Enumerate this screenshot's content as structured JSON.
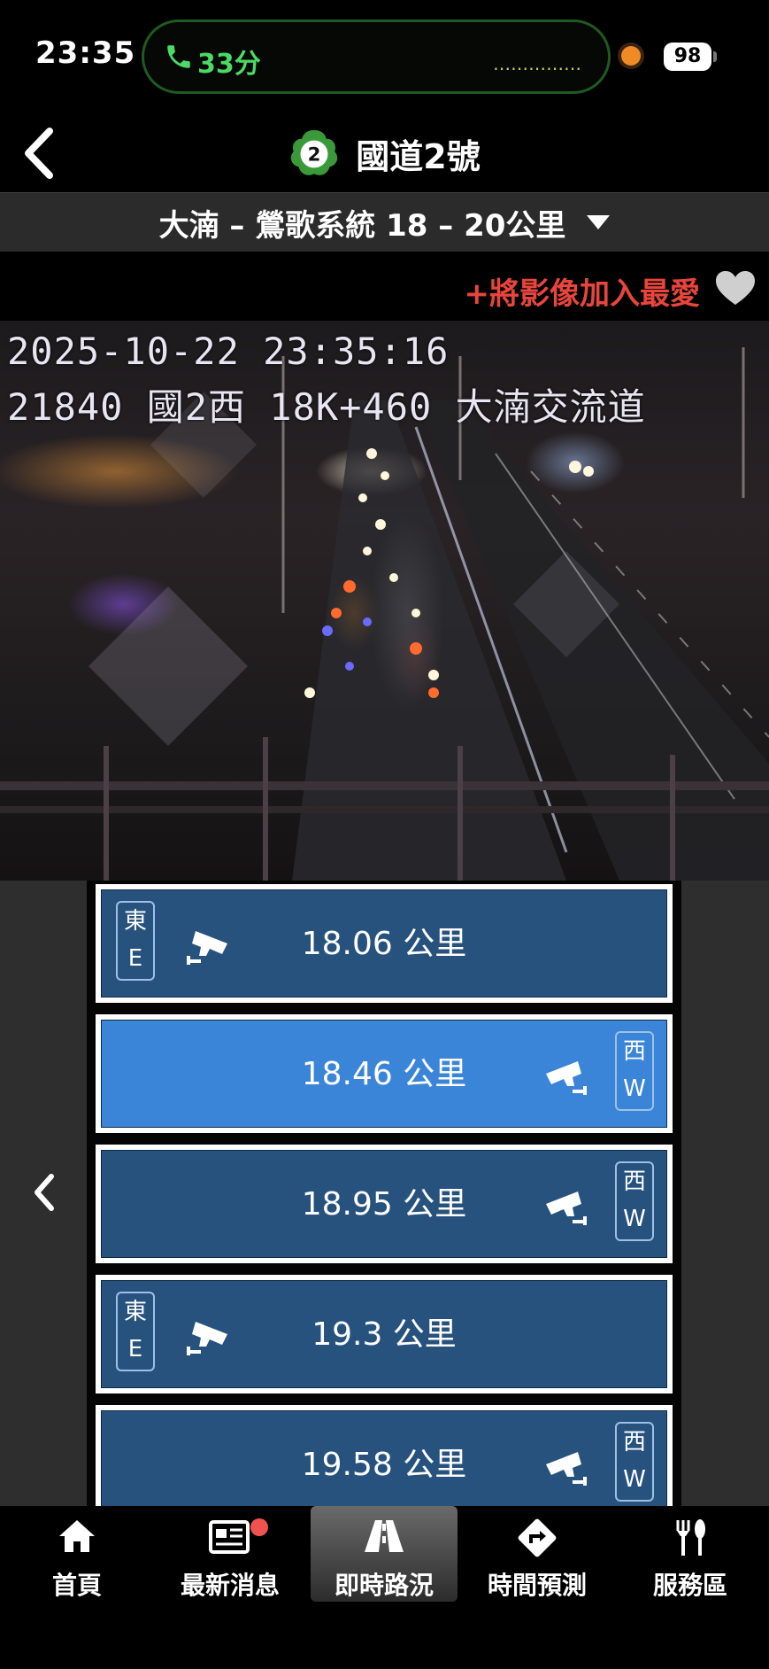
{
  "status_bar": {
    "time": "23:35",
    "call_duration": "33分",
    "battery": "98",
    "colors": {
      "call_green": "#4cd964",
      "record_dot": "#f08a24"
    }
  },
  "header": {
    "title": "國道2號",
    "route_number": "2",
    "back_icon": "chevron-left-icon"
  },
  "segment": {
    "label": "大湳 – 鶯歌系統 18 – 20公里",
    "dropdown_icon": "caret-down-icon"
  },
  "favorite": {
    "label": "+將影像加入最愛",
    "icon": "heart-icon",
    "color": "#e8453c"
  },
  "camera_feed": {
    "timestamp": "2025-10-22 23:35:16",
    "location": "21840  國2西  18K+460 大湳交流道"
  },
  "camera_list": {
    "row_color": "#27527e",
    "selected_color": "#3b85d9",
    "items": [
      {
        "km": "18.06 公里",
        "dir_zh": "東",
        "dir_en": "E",
        "side": "left",
        "selected": false
      },
      {
        "km": "18.46 公里",
        "dir_zh": "西",
        "dir_en": "W",
        "side": "right",
        "selected": true
      },
      {
        "km": "18.95 公里",
        "dir_zh": "西",
        "dir_en": "W",
        "side": "right",
        "selected": false
      },
      {
        "km": "19.3 公里",
        "dir_zh": "東",
        "dir_en": "E",
        "side": "left",
        "selected": false
      },
      {
        "km": "19.58 公里",
        "dir_zh": "西",
        "dir_en": "W",
        "side": "right",
        "selected": false
      }
    ]
  },
  "tab_bar": {
    "tabs": [
      {
        "label": "首頁",
        "icon": "home-icon",
        "active": false
      },
      {
        "label": "最新消息",
        "icon": "news-icon",
        "active": false,
        "badge": true
      },
      {
        "label": "即時路況",
        "icon": "road-icon",
        "active": true
      },
      {
        "label": "時間預測",
        "icon": "route-sign-icon",
        "active": false
      },
      {
        "label": "服務區",
        "icon": "fork-knife-icon",
        "active": false
      }
    ]
  }
}
